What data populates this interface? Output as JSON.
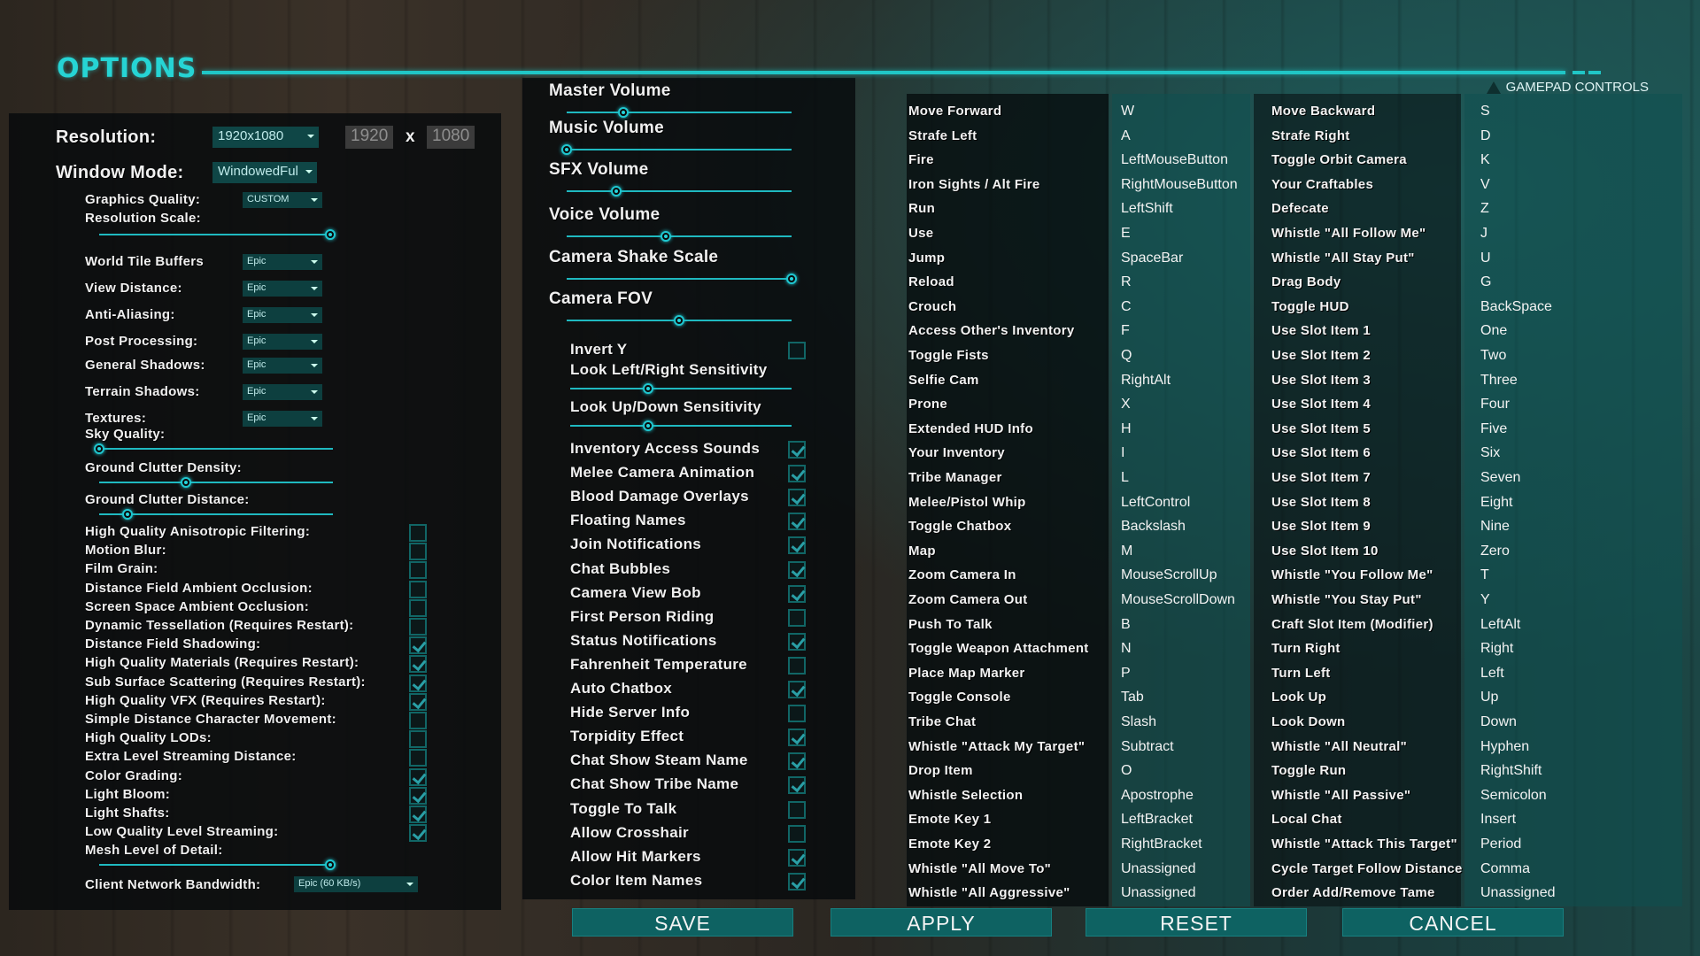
{
  "title": "OPTIONS",
  "gamepad_label": "GAMEPAD CONTROLS",
  "resolution": {
    "label": "Resolution:",
    "value": "1920x1080",
    "width": "1920",
    "x": "x",
    "height": "1080"
  },
  "window_mode": {
    "label": "Window Mode:",
    "value": "WindowedFul"
  },
  "graphics_quality": {
    "label": "Graphics Quality:",
    "value": "CUSTOM"
  },
  "resolution_scale": {
    "label": "Resolution Scale:",
    "level": 0.99
  },
  "quality_settings": [
    {
      "label": "World Tile Buffers",
      "value": "Epic"
    },
    {
      "label": "View Distance:",
      "value": "Epic"
    },
    {
      "label": "Anti-Aliasing:",
      "value": "Epic"
    },
    {
      "label": "Post Processing:",
      "value": "Epic"
    },
    {
      "label": "General Shadows:",
      "value": "Epic"
    },
    {
      "label": "Terrain Shadows:",
      "value": "Epic"
    },
    {
      "label": "Textures:",
      "value": "Epic"
    }
  ],
  "left_sliders": [
    {
      "label": "Sky Quality:",
      "level": 0.0
    },
    {
      "label": "Ground Clutter Density:",
      "level": 0.37
    },
    {
      "label": "Ground Clutter Distance:",
      "level": 0.12
    }
  ],
  "left_checks": [
    {
      "label": "High Quality Anisotropic Filtering:",
      "checked": false
    },
    {
      "label": "Motion Blur:",
      "checked": false
    },
    {
      "label": "Film Grain:",
      "checked": false
    },
    {
      "label": "Distance Field Ambient Occlusion:",
      "checked": false
    },
    {
      "label": "Screen Space Ambient Occlusion:",
      "checked": false
    },
    {
      "label": "Dynamic Tessellation (Requires Restart):",
      "checked": false
    },
    {
      "label": "Distance Field Shadowing:",
      "checked": true
    },
    {
      "label": "High Quality Materials (Requires Restart):",
      "checked": true
    },
    {
      "label": "Sub Surface Scattering (Requires Restart):",
      "checked": true
    },
    {
      "label": "High Quality VFX (Requires Restart):",
      "checked": true
    },
    {
      "label": "Simple Distance Character Movement:",
      "checked": false
    },
    {
      "label": "High Quality LODs:",
      "checked": false
    },
    {
      "label": "Extra Level Streaming Distance:",
      "checked": false
    },
    {
      "label": "Color Grading:",
      "checked": true
    },
    {
      "label": "Light Bloom:",
      "checked": true
    },
    {
      "label": "Light Shafts:",
      "checked": true
    },
    {
      "label": "Low Quality Level Streaming:",
      "checked": true
    }
  ],
  "mesh_lod": {
    "label": "Mesh Level of Detail:",
    "level": 0.99
  },
  "bandwidth": {
    "label": "Client Network Bandwidth:",
    "value": "Epic (60 KB/s)"
  },
  "audio_sliders": [
    {
      "label": "Master Volume",
      "level": 0.25
    },
    {
      "label": "Music Volume",
      "level": 0.0
    },
    {
      "label": "SFX Volume",
      "level": 0.22
    },
    {
      "label": "Voice Volume",
      "level": 0.44
    },
    {
      "label": "Camera Shake Scale",
      "level": 1.0
    },
    {
      "label": "Camera FOV",
      "level": 0.5
    }
  ],
  "invert_y": {
    "label": "Invert Y",
    "checked": false
  },
  "sensitivity_sliders": [
    {
      "label": "Look Left/Right Sensitivity",
      "level": 0.35
    },
    {
      "label": "Look Up/Down Sensitivity",
      "level": 0.35
    }
  ],
  "mid_checks": [
    {
      "label": "Inventory Access Sounds",
      "checked": true
    },
    {
      "label": "Melee Camera Animation",
      "checked": true
    },
    {
      "label": "Blood Damage Overlays",
      "checked": true
    },
    {
      "label": "Floating Names",
      "checked": true
    },
    {
      "label": "Join Notifications",
      "checked": true
    },
    {
      "label": "Chat Bubbles",
      "checked": true
    },
    {
      "label": "Camera View Bob",
      "checked": true
    },
    {
      "label": "First Person Riding",
      "checked": false
    },
    {
      "label": "Status Notifications",
      "checked": true
    },
    {
      "label": "Fahrenheit Temperature",
      "checked": false
    },
    {
      "label": "Auto Chatbox",
      "checked": true
    },
    {
      "label": "Hide Server Info",
      "checked": false
    },
    {
      "label": "Torpidity Effect",
      "checked": true
    },
    {
      "label": "Chat Show Steam Name",
      "checked": true
    },
    {
      "label": "Chat Show Tribe Name",
      "checked": true
    },
    {
      "label": "Toggle To Talk",
      "checked": false
    },
    {
      "label": "Allow Crosshair",
      "checked": false
    },
    {
      "label": "Allow Hit Markers",
      "checked": true
    },
    {
      "label": "Color Item Names",
      "checked": true
    }
  ],
  "keybinds_left": [
    {
      "action": "Move Forward",
      "key": "W"
    },
    {
      "action": "Strafe Left",
      "key": "A"
    },
    {
      "action": "Fire",
      "key": "LeftMouseButton"
    },
    {
      "action": "Iron Sights / Alt Fire",
      "key": "RightMouseButton"
    },
    {
      "action": "Run",
      "key": "LeftShift"
    },
    {
      "action": "Use",
      "key": "E"
    },
    {
      "action": "Jump",
      "key": "SpaceBar"
    },
    {
      "action": "Reload",
      "key": "R"
    },
    {
      "action": "Crouch",
      "key": "C"
    },
    {
      "action": "Access Other's Inventory",
      "key": "F"
    },
    {
      "action": "Toggle Fists",
      "key": "Q"
    },
    {
      "action": "Selfie Cam",
      "key": "RightAlt"
    },
    {
      "action": "Prone",
      "key": "X"
    },
    {
      "action": "Extended HUD Info",
      "key": "H"
    },
    {
      "action": "Your Inventory",
      "key": "I"
    },
    {
      "action": "Tribe Manager",
      "key": "L"
    },
    {
      "action": "Melee/Pistol Whip",
      "key": "LeftControl"
    },
    {
      "action": "Toggle Chatbox",
      "key": "Backslash"
    },
    {
      "action": "Map",
      "key": "M"
    },
    {
      "action": "Zoom Camera In",
      "key": "MouseScrollUp"
    },
    {
      "action": "Zoom Camera Out",
      "key": "MouseScrollDown"
    },
    {
      "action": "Push To Talk",
      "key": "B"
    },
    {
      "action": "Toggle Weapon Attachment",
      "key": "N"
    },
    {
      "action": "Place Map Marker",
      "key": "P"
    },
    {
      "action": "Toggle Console",
      "key": "Tab"
    },
    {
      "action": "Tribe Chat",
      "key": "Slash"
    },
    {
      "action": "Whistle \"Attack My Target\"",
      "key": "Subtract"
    },
    {
      "action": "Drop Item",
      "key": "O"
    },
    {
      "action": "Whistle Selection",
      "key": "Apostrophe"
    },
    {
      "action": "Emote Key 1",
      "key": "LeftBracket"
    },
    {
      "action": "Emote Key 2",
      "key": "RightBracket"
    },
    {
      "action": "Whistle \"All Move To\"",
      "key": "Unassigned"
    },
    {
      "action": "Whistle \"All Aggressive\"",
      "key": "Unassigned"
    }
  ],
  "keybinds_right": [
    {
      "action": "Move Backward",
      "key": "S"
    },
    {
      "action": "Strafe Right",
      "key": "D"
    },
    {
      "action": "Toggle Orbit Camera",
      "key": "K"
    },
    {
      "action": "Your Craftables",
      "key": "V"
    },
    {
      "action": "Defecate",
      "key": "Z"
    },
    {
      "action": "Whistle \"All Follow Me\"",
      "key": "J"
    },
    {
      "action": "Whistle \"All Stay Put\"",
      "key": "U"
    },
    {
      "action": "Drag Body",
      "key": "G"
    },
    {
      "action": "Toggle HUD",
      "key": "BackSpace"
    },
    {
      "action": "Use Slot Item 1",
      "key": "One"
    },
    {
      "action": "Use Slot Item 2",
      "key": "Two"
    },
    {
      "action": "Use Slot Item 3",
      "key": "Three"
    },
    {
      "action": "Use Slot Item 4",
      "key": "Four"
    },
    {
      "action": "Use Slot Item 5",
      "key": "Five"
    },
    {
      "action": "Use Slot Item 6",
      "key": "Six"
    },
    {
      "action": "Use Slot Item 7",
      "key": "Seven"
    },
    {
      "action": "Use Slot Item 8",
      "key": "Eight"
    },
    {
      "action": "Use Slot Item 9",
      "key": "Nine"
    },
    {
      "action": "Use Slot Item 10",
      "key": "Zero"
    },
    {
      "action": "Whistle \"You Follow Me\"",
      "key": "T"
    },
    {
      "action": "Whistle \"You Stay Put\"",
      "key": "Y"
    },
    {
      "action": "Craft Slot Item (Modifier)",
      "key": "LeftAlt"
    },
    {
      "action": "Turn Right",
      "key": "Right"
    },
    {
      "action": "Turn Left",
      "key": "Left"
    },
    {
      "action": "Look Up",
      "key": "Up"
    },
    {
      "action": "Look Down",
      "key": "Down"
    },
    {
      "action": "Whistle \"All Neutral\"",
      "key": "Hyphen"
    },
    {
      "action": "Toggle Run",
      "key": "RightShift"
    },
    {
      "action": "Whistle \"All Passive\"",
      "key": "Semicolon"
    },
    {
      "action": "Local Chat",
      "key": "Insert"
    },
    {
      "action": "Whistle \"Attack This Target\"",
      "key": "Period"
    },
    {
      "action": "Cycle Target Follow Distance",
      "key": "Comma"
    },
    {
      "action": "Order Add/Remove Tame",
      "key": "Unassigned"
    }
  ],
  "buttons": {
    "save": "SAVE",
    "apply": "APPLY",
    "reset": "RESET",
    "cancel": "CANCEL"
  },
  "colors": {
    "accent": "#20c6c6",
    "button": "#0e6262",
    "key_column": "#0f5050"
  }
}
